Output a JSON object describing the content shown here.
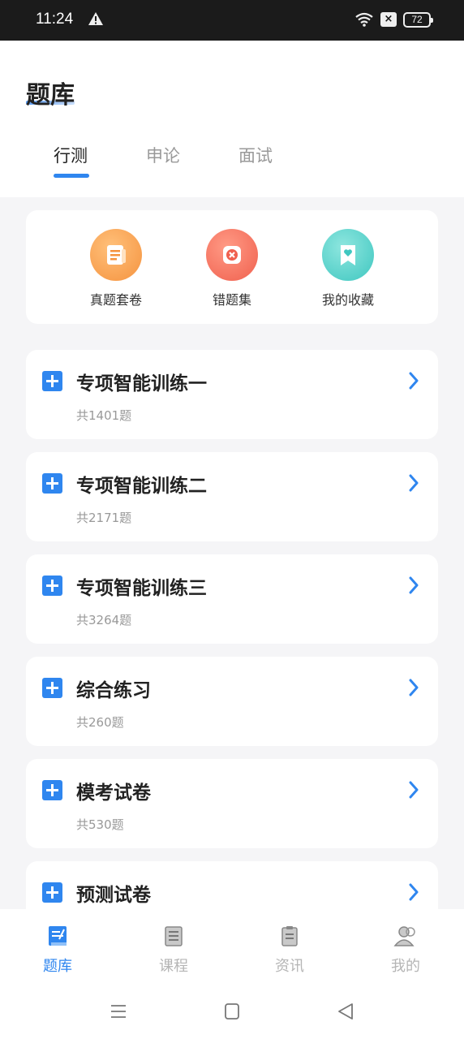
{
  "status_bar": {
    "time": "11:24",
    "battery": "72",
    "icons": [
      "warning-icon",
      "wifi-icon",
      "close-box-icon",
      "battery-icon"
    ]
  },
  "header": {
    "title": "题库",
    "tabs": [
      {
        "label": "行测",
        "active": true
      },
      {
        "label": "申论",
        "active": false
      },
      {
        "label": "面试",
        "active": false
      }
    ]
  },
  "quick_actions": [
    {
      "label": "真题套卷",
      "icon": "paper-icon",
      "color": "#f5933f"
    },
    {
      "label": "错题集",
      "icon": "wrong-icon",
      "color": "#f0604e"
    },
    {
      "label": "我的收藏",
      "icon": "bookmark-heart-icon",
      "color": "#3fc7c0"
    }
  ],
  "practice_list": [
    {
      "title": "专项智能训练一",
      "count": "共1401题"
    },
    {
      "title": "专项智能训练二",
      "count": "共2171题"
    },
    {
      "title": "专项智能训练三",
      "count": "共3264题"
    },
    {
      "title": "综合练习",
      "count": "共260题"
    },
    {
      "title": "模考试卷",
      "count": "共530题"
    },
    {
      "title": "预测试卷",
      "count": ""
    }
  ],
  "bottom_nav": [
    {
      "label": "题库",
      "icon": "question-bank-icon",
      "active": true
    },
    {
      "label": "课程",
      "icon": "course-icon",
      "active": false
    },
    {
      "label": "资讯",
      "icon": "news-icon",
      "active": false
    },
    {
      "label": "我的",
      "icon": "profile-icon",
      "active": false
    }
  ],
  "colors": {
    "accent": "#2f86ef",
    "background": "#f5f5f7",
    "muted_text": "#999999"
  }
}
